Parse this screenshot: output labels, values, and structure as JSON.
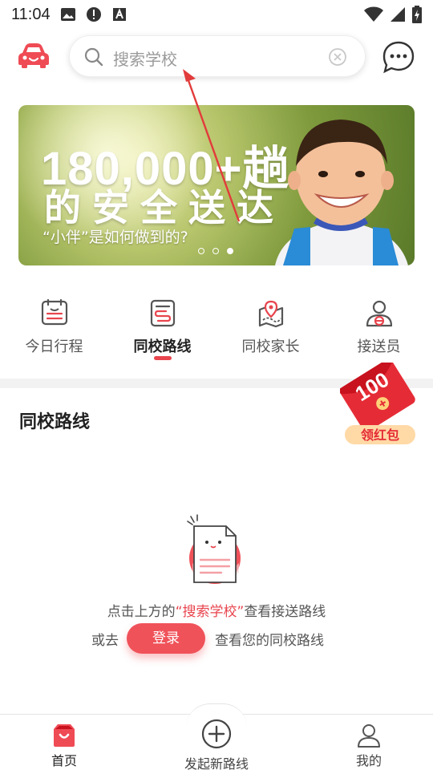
{
  "status_bar": {
    "time": "11:04",
    "icons": [
      "gallery-icon",
      "alert-icon",
      "font-icon"
    ],
    "right_icons": [
      "wifi-icon",
      "signal-icon",
      "battery-icon"
    ]
  },
  "header": {
    "search_placeholder": "搜索学校",
    "logo_icon": "car-logo-icon",
    "message_icon": "chat-bubble-icon"
  },
  "banner": {
    "headline": "180,000+趟",
    "headline2": "的安全送达",
    "subtitle": "“小伴”是如何做到的?",
    "page_count": 3,
    "active_page": 3
  },
  "quick_nav": [
    {
      "label": "今日行程",
      "icon": "calendar-icon",
      "active": false
    },
    {
      "label": "同校路线",
      "icon": "route-icon",
      "active": true
    },
    {
      "label": "同校家长",
      "icon": "map-pin-icon",
      "active": false
    },
    {
      "label": "接送员",
      "icon": "driver-icon",
      "active": false
    }
  ],
  "section": {
    "title": "同校路线"
  },
  "red_packet": {
    "amount": "100",
    "label": "领红包"
  },
  "empty_state": {
    "prefix": "点击上方的",
    "link": "“搜索学校”",
    "suffix": "查看接送路线",
    "or_go": "或去",
    "login": "登录",
    "after_login": "查看您的同校路线"
  },
  "tab_bar": {
    "home": "首页",
    "new_route": "发起新路线",
    "mine": "我的"
  },
  "colors": {
    "accent": "#e8454e",
    "divider": "#f2f2f2"
  }
}
